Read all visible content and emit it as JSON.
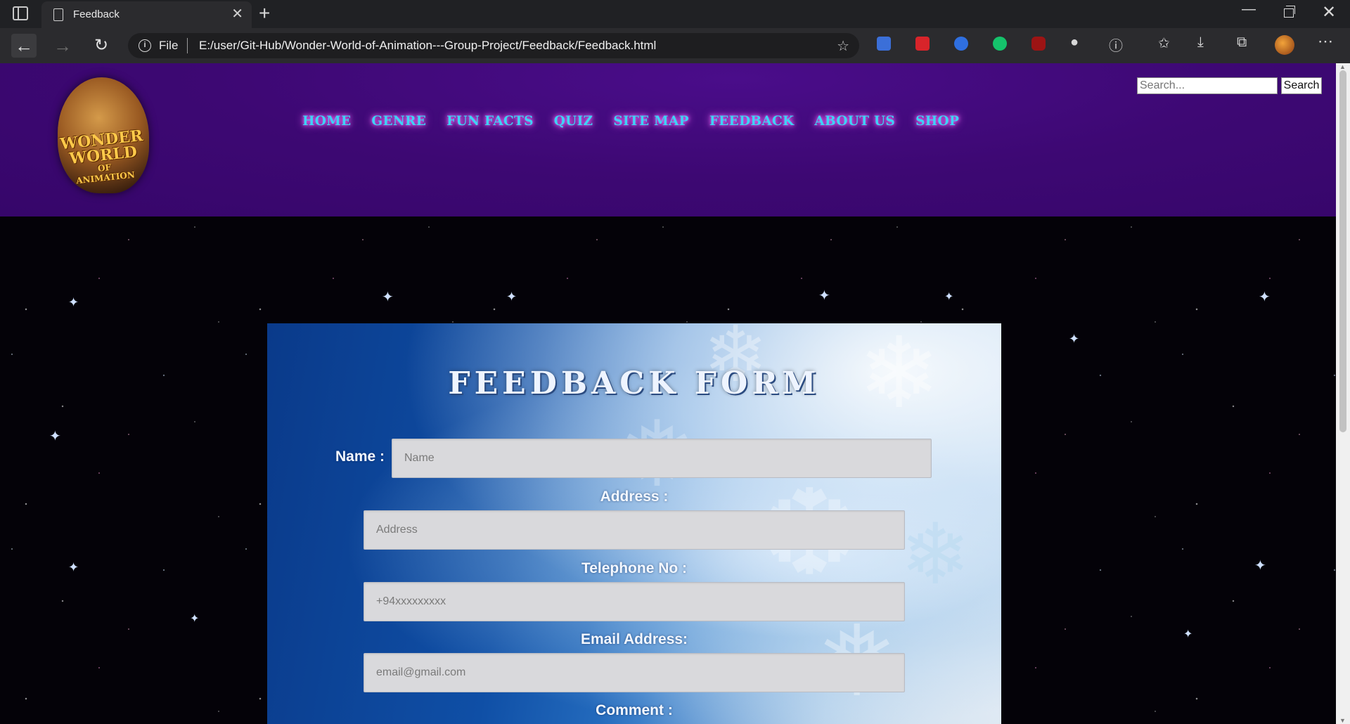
{
  "browser": {
    "tab_title": "Feedback",
    "url_scheme": "File",
    "url": "E:/user/Git-Hub/Wonder-World-of-Animation---Group-Project/Feedback/Feedback.html"
  },
  "header": {
    "logo_text_top": "WONDER WORLD",
    "logo_text_mid": "OF",
    "logo_text_bottom": "ANIMATION",
    "nav": [
      "HOME",
      "GENRE",
      "FUN FACTS",
      "QUIZ",
      "SITE MAP",
      "FEEDBACK",
      "ABOUT US",
      "SHOP"
    ],
    "search_placeholder": "Search...",
    "search_button": "Search"
  },
  "form": {
    "title": "FEEDBACK FORM",
    "name_label": "Name :",
    "name_placeholder": "Name",
    "address_label": "Address :",
    "address_placeholder": "Address",
    "phone_label": "Telephone No :",
    "phone_placeholder": "+94xxxxxxxxx",
    "email_label": "Email Address:",
    "email_placeholder": "email@gmail.com",
    "comment_label": "Comment :"
  },
  "colors": {
    "header_bg": "#3d0873",
    "nav_link": "#3fd2f5",
    "nav_glow": "#ff6bff"
  }
}
